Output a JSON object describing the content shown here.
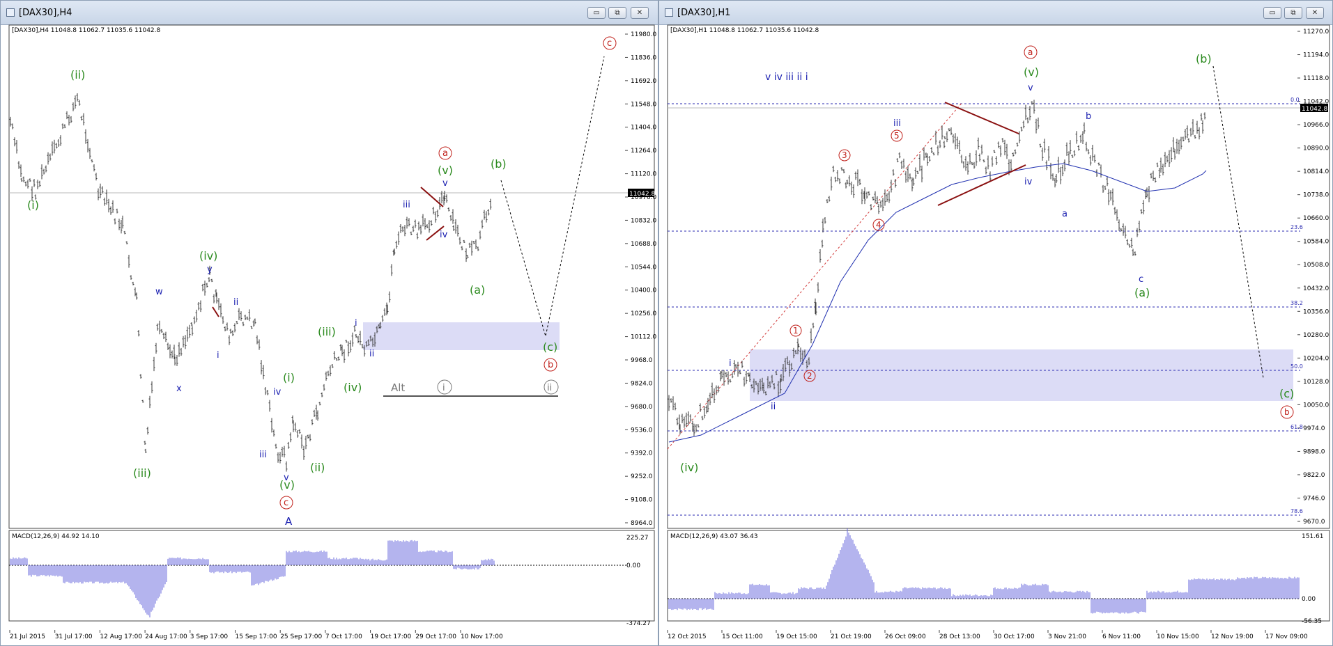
{
  "windows": {
    "left": {
      "title": "[DAX30],H4",
      "header": "[DAX30],H4  11048.8 11062.7 11035.6 11042.8",
      "price_ticks": [
        "11980.0",
        "11836.0",
        "11692.0",
        "11548.0",
        "11404.0",
        "11264.0",
        "11120.0",
        "10976.0",
        "10832.0",
        "10688.0",
        "10544.0",
        "10400.0",
        "10256.0",
        "10112.0",
        "9968.0",
        "9824.0",
        "9680.0",
        "9536.0",
        "9392.0",
        "9252.0",
        "9108.0",
        "8964.0"
      ],
      "current_price": "11042.8",
      "time_ticks": [
        "21 Jul 2015",
        "31 Jul 17:00",
        "12 Aug 17:00",
        "24 Aug 17:00",
        "3 Sep 17:00",
        "15 Sep 17:00",
        "25 Sep 17:00",
        "7 Oct 17:00",
        "19 Oct 17:00",
        "29 Oct 17:00",
        "10 Nov 17:00"
      ],
      "macd_label": "MACD(12,26,9) 44.92 14.10",
      "macd_ticks": [
        "225.27",
        "0.00",
        "-374.27"
      ],
      "alt_label": "Alt",
      "labels": {
        "i_green": "(i)",
        "ii_green": "(ii)",
        "iii_green": "(iii)",
        "iv_green": "(iv)",
        "v_green": "(v)",
        "w": "w",
        "x": "x",
        "y": "y",
        "i_blue": "i",
        "ii_blue": "ii",
        "iv_blue": "iv",
        "iii_blue": "iii",
        "v_blue": "v",
        "c_circle": "c",
        "A": "A",
        "i2_green": "(i)",
        "ii2_green": "(ii)",
        "iii2_green": "(iii)",
        "iv2_green": "(iv)",
        "i2_blue": "i",
        "ii2_blue": "ii",
        "iii2_blue": "iii",
        "iv2_blue": "iv",
        "v2_blue": "v",
        "v2_green": "(v)",
        "a_circle": "a",
        "a_green": "(a)",
        "b_green": "(b)",
        "c_green": "(c)",
        "b_circle": "b",
        "c_top_circle": "c",
        "alt_i": "i",
        "alt_ii": "ii"
      }
    },
    "right": {
      "title": "[DAX30],H1",
      "header": "[DAX30],H1  11048.8 11062.7 11035.6 11042.8",
      "price_ticks": [
        "11270.0",
        "11194.0",
        "11118.0",
        "11042.0",
        "10966.0",
        "10890.0",
        "10814.0",
        "10738.0",
        "10660.0",
        "10584.0",
        "10508.0",
        "10432.0",
        "10356.0",
        "10280.0",
        "10204.0",
        "10128.0",
        "10050.0",
        "9974.0",
        "9898.0",
        "9822.0",
        "9746.0",
        "9670.0"
      ],
      "current_price": "11042.8",
      "fib_levels": [
        "0.0",
        "23.6",
        "38.2",
        "50.0",
        "61.8",
        "78.6"
      ],
      "time_ticks": [
        "12 Oct 2015",
        "15 Oct 11:00",
        "19 Oct 15:00",
        "21 Oct 19:00",
        "26 Oct 09:00",
        "28 Oct 13:00",
        "30 Oct 17:00",
        "3 Nov 21:00",
        "6 Nov 11:00",
        "10 Nov 15:00",
        "12 Nov 19:00",
        "17 Nov 09:00"
      ],
      "macd_label": "MACD(12,26,9) 43.07 36.43",
      "macd_ticks": [
        "151.61",
        "0.00",
        "-56.35"
      ],
      "labels": {
        "top_blue": "v iv iii ii i",
        "iv_green": "(iv)",
        "i_blue": "i",
        "ii_blue": "ii",
        "n1": "1",
        "n2": "2",
        "n3": "3",
        "n4": "4",
        "n5": "5",
        "iii_blue": "iii",
        "iv_blue": "iv",
        "v_blue": "v",
        "v_green": "(v)",
        "a_circle": "a",
        "a_small": "a",
        "b_small": "b",
        "c_small": "c",
        "a_green": "(a)",
        "b_green": "(b)",
        "c_green": "(c)",
        "b_circle": "b"
      }
    }
  },
  "window_buttons": {
    "minimize": "▭",
    "restore": "⧉",
    "close": "✕"
  },
  "colors": {
    "bar": "#3a3a3a",
    "green": "#2b8a1e",
    "blue": "#1a1fb0",
    "red": "#c0201a",
    "zone": "#dcdcf6",
    "fib": "#2a2ab0",
    "macd": "#6a6adc",
    "ma": "#2030b0"
  }
}
